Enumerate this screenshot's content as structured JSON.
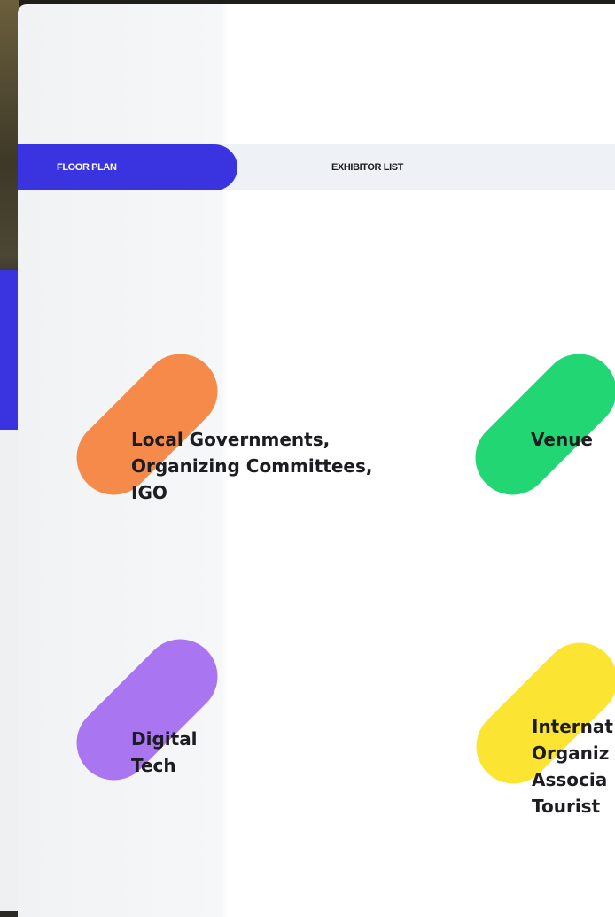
{
  "tabs": [
    {
      "label": "FLOOR PLAN",
      "active": true
    },
    {
      "label": "EXHIBITOR LIST",
      "active": false
    }
  ],
  "categories": [
    {
      "lines": [
        "Local Governments,",
        "Organizing Committees,",
        "IGO"
      ],
      "color": "#f58a4a"
    },
    {
      "lines": [
        "Venue"
      ],
      "color": "#22d673"
    },
    {
      "lines": [
        "Digital",
        "Tech"
      ],
      "color": "#a975f0"
    },
    {
      "lines": [
        "Internat",
        "Organiz",
        "Associa",
        "Tourist"
      ],
      "color": "#fbe532"
    }
  ],
  "colors": {
    "accent": "#3a34e0",
    "tab_bar": "#eef1f6"
  }
}
